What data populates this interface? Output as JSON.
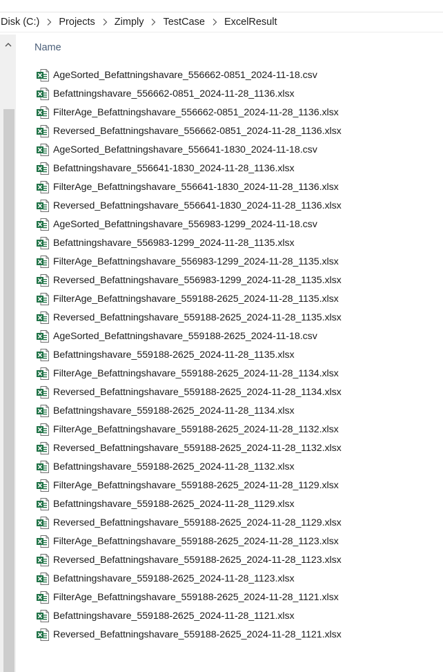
{
  "breadcrumb": [
    "Disk (C:)",
    "Projects",
    "Zimply",
    "TestCase",
    "ExcelResult"
  ],
  "list_header": {
    "name_label": "Name"
  },
  "file_icon": "excel-file-icon",
  "colors": {
    "excel_green": "#1e7145",
    "header_text": "#4c607a",
    "scrollbar_track": "#f0f0f0",
    "scrollbar_thumb": "#cdcdcd"
  },
  "files": [
    "AgeSorted_Befattningshavare_556662-0851_2024-11-18.csv",
    "Befattningshavare_556662-0851_2024-11-28_1136.xlsx",
    "FilterAge_Befattningshavare_556662-0851_2024-11-28_1136.xlsx",
    "Reversed_Befattningshavare_556662-0851_2024-11-28_1136.xlsx",
    "AgeSorted_Befattningshavare_556641-1830_2024-11-18.csv",
    "Befattningshavare_556641-1830_2024-11-28_1136.xlsx",
    "FilterAge_Befattningshavare_556641-1830_2024-11-28_1136.xlsx",
    "Reversed_Befattningshavare_556641-1830_2024-11-28_1136.xlsx",
    "AgeSorted_Befattningshavare_556983-1299_2024-11-18.csv",
    "Befattningshavare_556983-1299_2024-11-28_1135.xlsx",
    "FilterAge_Befattningshavare_556983-1299_2024-11-28_1135.xlsx",
    "Reversed_Befattningshavare_556983-1299_2024-11-28_1135.xlsx",
    "FilterAge_Befattningshavare_559188-2625_2024-11-28_1135.xlsx",
    "Reversed_Befattningshavare_559188-2625_2024-11-28_1135.xlsx",
    "AgeSorted_Befattningshavare_559188-2625_2024-11-18.csv",
    "Befattningshavare_559188-2625_2024-11-28_1135.xlsx",
    "FilterAge_Befattningshavare_559188-2625_2024-11-28_1134.xlsx",
    "Reversed_Befattningshavare_559188-2625_2024-11-28_1134.xlsx",
    "Befattningshavare_559188-2625_2024-11-28_1134.xlsx",
    "FilterAge_Befattningshavare_559188-2625_2024-11-28_1132.xlsx",
    "Reversed_Befattningshavare_559188-2625_2024-11-28_1132.xlsx",
    "Befattningshavare_559188-2625_2024-11-28_1132.xlsx",
    "FilterAge_Befattningshavare_559188-2625_2024-11-28_1129.xlsx",
    "Befattningshavare_559188-2625_2024-11-28_1129.xlsx",
    "Reversed_Befattningshavare_559188-2625_2024-11-28_1129.xlsx",
    "FilterAge_Befattningshavare_559188-2625_2024-11-28_1123.xlsx",
    "Reversed_Befattningshavare_559188-2625_2024-11-28_1123.xlsx",
    "Befattningshavare_559188-2625_2024-11-28_1123.xlsx",
    "FilterAge_Befattningshavare_559188-2625_2024-11-28_1121.xlsx",
    "Befattningshavare_559188-2625_2024-11-28_1121.xlsx",
    "Reversed_Befattningshavare_559188-2625_2024-11-28_1121.xlsx"
  ]
}
